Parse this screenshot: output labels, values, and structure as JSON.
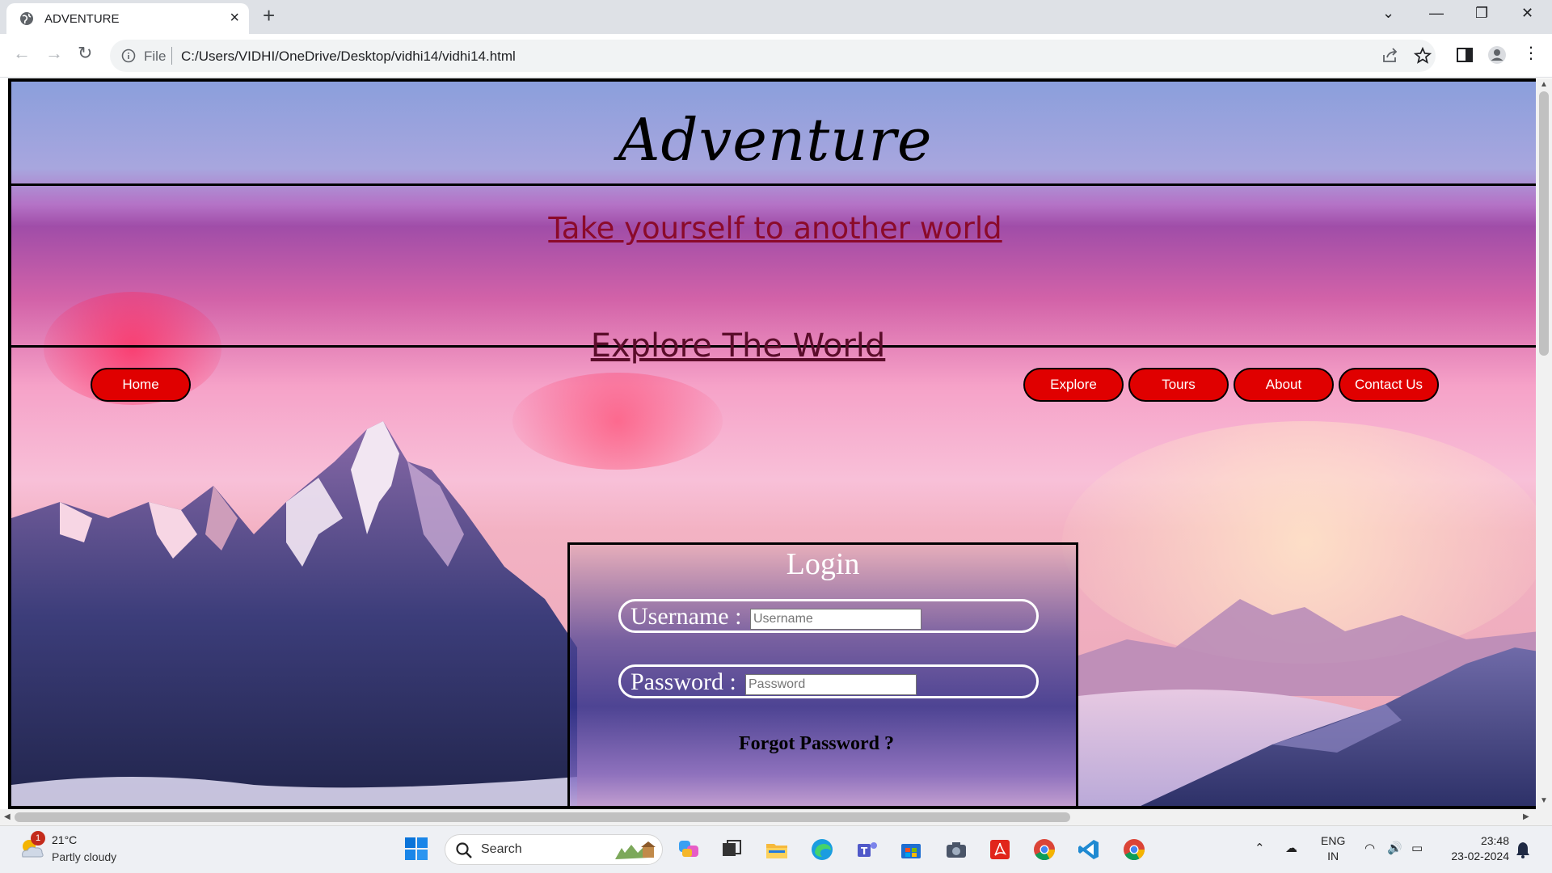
{
  "browser": {
    "tab_title": "ADVENTURE",
    "new_tab_glyph": "+",
    "omnibox_scheme": "File",
    "url": "C:/Users/VIDHI/OneDrive/Desktop/vidhi14/vidhi14.html"
  },
  "site": {
    "logo": "Adventure",
    "tagline": "Take yourself to another world",
    "explore_title": "Explore The World",
    "nav": {
      "home": "Home",
      "explore": "Explore",
      "tours": "Tours",
      "about": "About",
      "contact": "Contact Us"
    },
    "colors": {
      "nav_button": "#e00000",
      "tagline": "#8b0a2a"
    }
  },
  "login": {
    "title": "Login",
    "username_label": "Username :",
    "username_placeholder": "Username",
    "password_label": "Password :",
    "password_placeholder": "Password",
    "forgot": "Forgot Password ?"
  },
  "taskbar": {
    "weather_temp": "21°C",
    "weather_cond": "Partly cloudy",
    "weather_badge": "1",
    "search_label": "Search",
    "lang_1": "ENG",
    "lang_2": "IN",
    "time": "23:48",
    "date": "23-02-2024"
  }
}
